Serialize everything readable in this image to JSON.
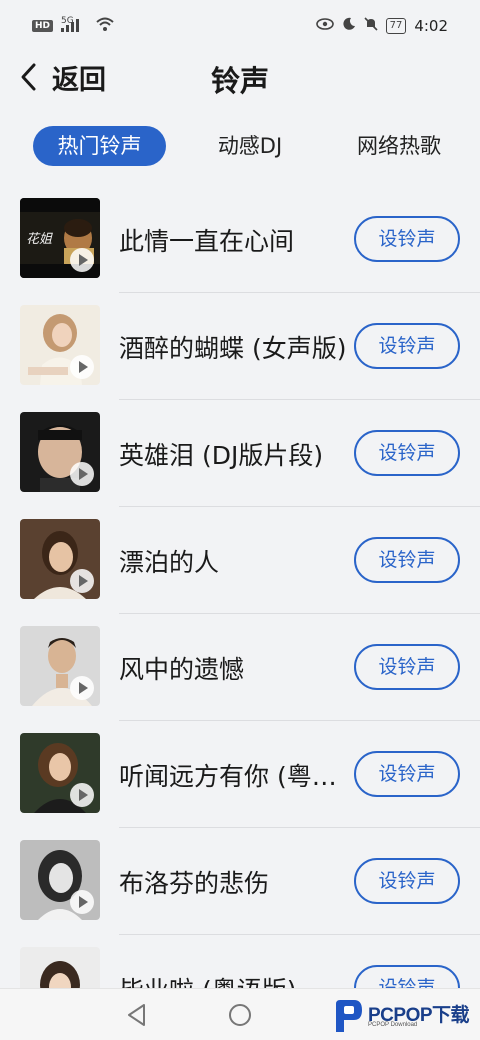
{
  "status_bar": {
    "hd": "HD",
    "signal": "5G",
    "battery": "77",
    "time": "4:02"
  },
  "header": {
    "back_label": "返回",
    "title": "铃声"
  },
  "tabs": [
    {
      "label": "热门铃声",
      "active": true
    },
    {
      "label": "动感DJ",
      "active": false
    },
    {
      "label": "网络热歌",
      "active": false
    }
  ],
  "songs": [
    {
      "title": "此情一直在心间",
      "button": "设铃声"
    },
    {
      "title": "酒醉的蝴蝶 (女声版)",
      "button": "设铃声"
    },
    {
      "title": "英雄泪 (DJ版片段)",
      "button": "设铃声"
    },
    {
      "title": "漂泊的人",
      "button": "设铃声"
    },
    {
      "title": "风中的遗憾",
      "button": "设铃声"
    },
    {
      "title": "听闻远方有你 (粤语版)",
      "button": "设铃声"
    },
    {
      "title": "布洛芬的悲伤",
      "button": "设铃声"
    },
    {
      "title": "毕业啦 (粤语版)",
      "button": "设铃声"
    }
  ],
  "thumb_overlay_text": "花姐",
  "watermark": {
    "name": "PCPOP下载",
    "sub": "PCPOP Download"
  },
  "colors": {
    "accent": "#2a64c9",
    "background": "#f2f3f5"
  }
}
